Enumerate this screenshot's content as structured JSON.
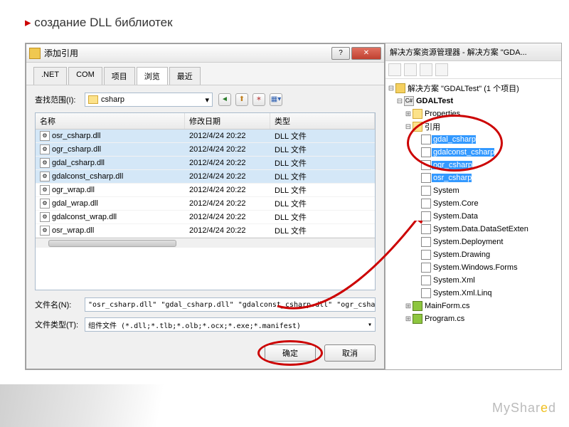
{
  "slide_title": "создание DLL библиотек",
  "dialog": {
    "title": "添加引用",
    "tabs": [
      ".NET",
      "COM",
      "项目",
      "浏览",
      "最近"
    ],
    "active_tab": 3,
    "lookup_label": "查找范围(I):",
    "folder_name": "csharp",
    "columns": {
      "name": "名称",
      "date": "修改日期",
      "type": "类型"
    },
    "files": [
      {
        "name": "osr_csharp.dll",
        "date": "2012/4/24 20:22",
        "type": "DLL 文件",
        "selected": true
      },
      {
        "name": "ogr_csharp.dll",
        "date": "2012/4/24 20:22",
        "type": "DLL 文件",
        "selected": true
      },
      {
        "name": "gdal_csharp.dll",
        "date": "2012/4/24 20:22",
        "type": "DLL 文件",
        "selected": true
      },
      {
        "name": "gdalconst_csharp.dll",
        "date": "2012/4/24 20:22",
        "type": "DLL 文件",
        "selected": true
      },
      {
        "name": "ogr_wrap.dll",
        "date": "2012/4/24 20:22",
        "type": "DLL 文件",
        "selected": false
      },
      {
        "name": "gdal_wrap.dll",
        "date": "2012/4/24 20:22",
        "type": "DLL 文件",
        "selected": false
      },
      {
        "name": "gdalconst_wrap.dll",
        "date": "2012/4/24 20:22",
        "type": "DLL 文件",
        "selected": false
      },
      {
        "name": "osr_wrap.dll",
        "date": "2012/4/24 20:22",
        "type": "DLL 文件",
        "selected": false
      }
    ],
    "filename_label": "文件名(N):",
    "filename_value": "\"osr_csharp.dll\" \"gdal_csharp.dll\" \"gdalconst_csharp.dll\" \"ogr_csharp",
    "filetype_label": "文件类型(T):",
    "filetype_value": "组件文件 (*.dll;*.tlb;*.olb;*.ocx;*.exe;*.manifest)",
    "ok": "确定",
    "cancel": "取消"
  },
  "solution": {
    "title": "解决方案资源管理器 - 解决方案 \"GDA...",
    "root": "解决方案 \"GDALTest\" (1 个项目)",
    "project": "GDALTest",
    "properties": "Properties",
    "references_label": "引用",
    "highlighted_refs": [
      "gdal_csharp",
      "gdalconst_csharp",
      "ogr_csharp",
      "osr_csharp"
    ],
    "other_refs": [
      "System",
      "System.Core",
      "System.Data",
      "System.Data.DataSetExten",
      "System.Deployment",
      "System.Drawing",
      "System.Windows.Forms",
      "System.Xml",
      "System.Xml.Linq"
    ],
    "files": [
      "MainForm.cs",
      "Program.cs"
    ]
  },
  "watermark": "MyShared"
}
